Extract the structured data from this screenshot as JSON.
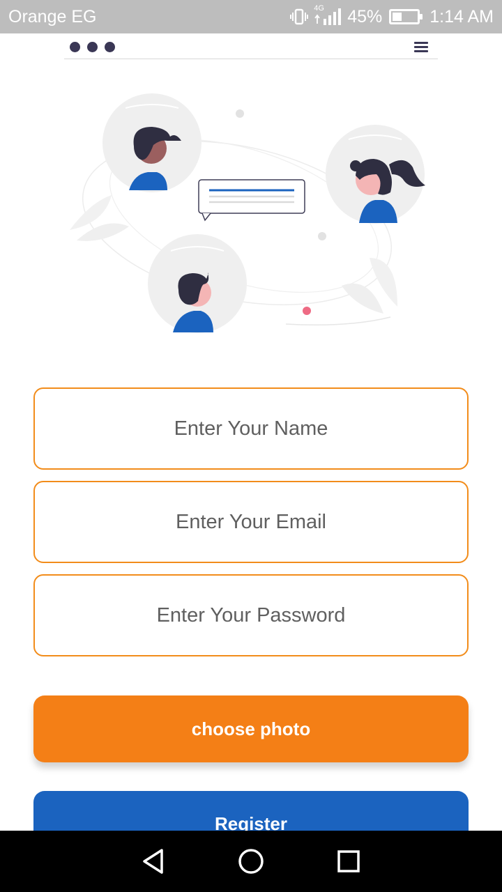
{
  "status_bar": {
    "carrier": "Orange EG",
    "network": "4G",
    "battery": "45%",
    "battery_level": 0.45,
    "time": "1:14 AM"
  },
  "header": {
    "dots_icon": "three-dots-icon",
    "menu_icon": "hamburger-menu-icon"
  },
  "illustration": {
    "name": "people-chat-illustration"
  },
  "form": {
    "name_placeholder": "Enter Your Name",
    "email_placeholder": "Enter Your Email",
    "password_placeholder": "Enter Your Password",
    "choose_photo_label": "choose photo",
    "register_label": "Register"
  },
  "colors": {
    "accent_orange": "#f47f16",
    "primary_blue": "#1b63bf",
    "status_bar": "#bdbdbd"
  },
  "nav_bar": {
    "back_icon": "back-triangle-icon",
    "home_icon": "home-circle-icon",
    "recents_icon": "recents-square-icon"
  }
}
